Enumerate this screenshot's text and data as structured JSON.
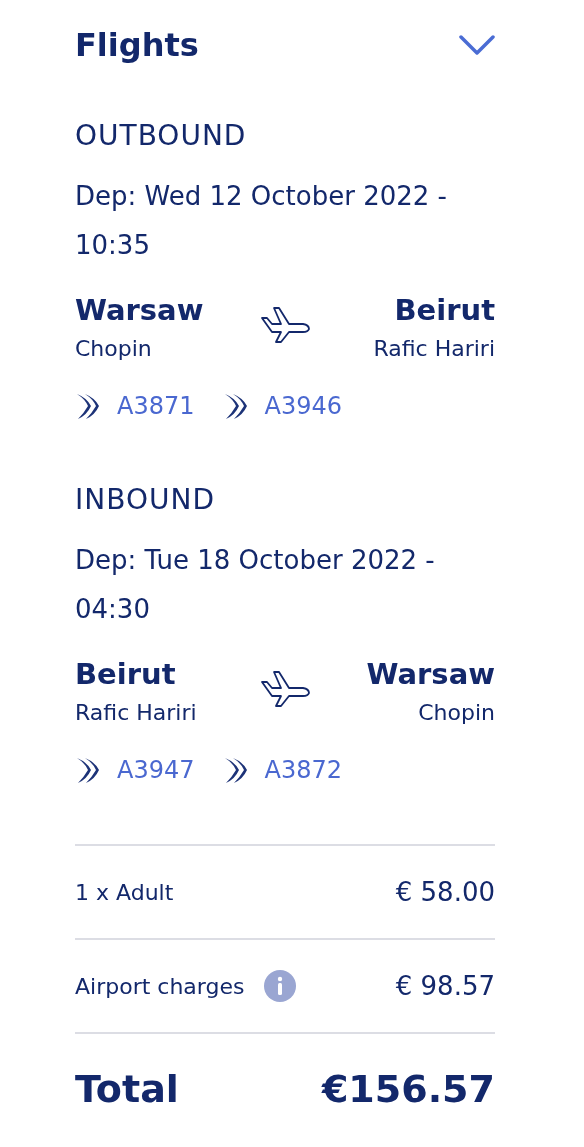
{
  "header": {
    "title": "Flights"
  },
  "legs": [
    {
      "label": "OUTBOUND",
      "departure": "Dep: Wed 12 October 2022 - 10:35",
      "from": {
        "city": "Warsaw",
        "airport": "Chopin"
      },
      "to": {
        "city": "Beirut",
        "airport": "Rafic Hariri"
      },
      "flights": [
        "A3871",
        "A3946"
      ]
    },
    {
      "label": "INBOUND",
      "departure": "Dep: Tue 18 October 2022 - 04:30",
      "from": {
        "city": "Beirut",
        "airport": "Rafic Hariri"
      },
      "to": {
        "city": "Warsaw",
        "airport": "Chopin"
      },
      "flights": [
        "A3947",
        "A3872"
      ]
    }
  ],
  "prices": [
    {
      "label": "1 x Adult",
      "amount": "€ 58.00",
      "info": false
    },
    {
      "label": "Airport charges",
      "amount": "€ 98.57",
      "info": true
    }
  ],
  "total": {
    "label": "Total",
    "amount": "€156.57"
  }
}
